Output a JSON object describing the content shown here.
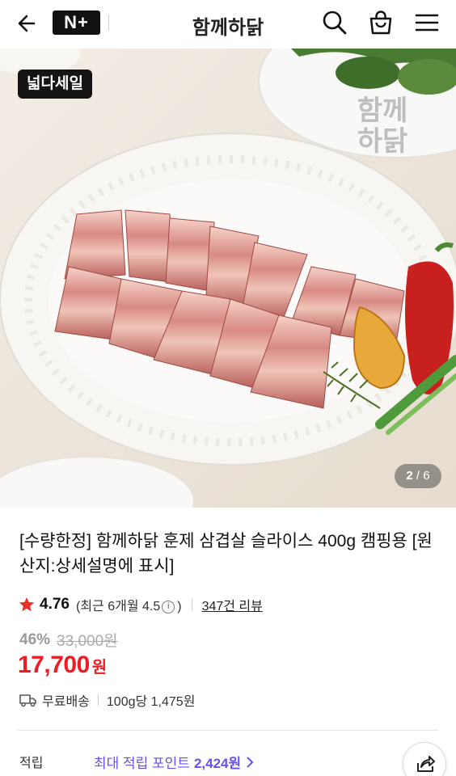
{
  "header": {
    "back_icon": "back-arrow-icon",
    "np_logo": "N+",
    "brand": "함께하닭",
    "icons": [
      "search-icon",
      "shopping-bag-icon",
      "menu-icon"
    ]
  },
  "gallery": {
    "sale_badge": "넓다세일",
    "watermark_line1": "함께",
    "watermark_line2": "하닭",
    "current_page": "2",
    "total_pages": "6"
  },
  "product": {
    "title": "[수량한정] 함께하닭 훈제 삼겹살 슬라이스 400g 캠핑용 [원산지:상세설명에 표시]",
    "rating": "4.76",
    "recent_rating_prefix": "(최근 6개월 4.5",
    "recent_rating_suffix": ")",
    "review_count": "347건 리뷰",
    "discount_percent": "46%",
    "original_price": "33,000원",
    "price": "17,700",
    "currency": "원",
    "shipping": "무료배송",
    "unit_price": "100g당 1,475원",
    "points_label": "적립",
    "points_text": "최대 적립 포인트",
    "points_value": "2,424원"
  },
  "colors": {
    "price_red": "#ee1c25",
    "point_purple": "#6b4ff0",
    "star_red": "#e8302a"
  }
}
